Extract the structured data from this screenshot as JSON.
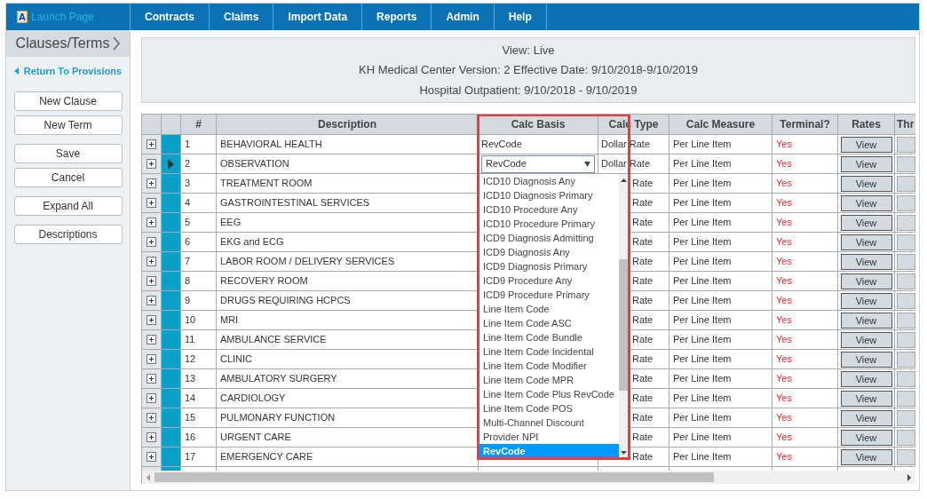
{
  "top_bar": {
    "launch_page": "Launch Page",
    "logo_letter": "A",
    "menu": [
      {
        "label": "Contracts"
      },
      {
        "label": "Claims"
      },
      {
        "label": "Import Data"
      },
      {
        "label": "Reports"
      },
      {
        "label": "Admin"
      },
      {
        "label": "Help"
      }
    ]
  },
  "sidebar": {
    "title": "Clauses/Terms",
    "back_link": "Return To Provisions",
    "button_groups": [
      [
        "New Clause",
        "New Term"
      ],
      [
        "Save",
        "Cancel"
      ],
      [
        "Expand All"
      ],
      [
        "Descriptions"
      ]
    ]
  },
  "header": {
    "lines": [
      "View: Live",
      "KH Medical Center Version: 2 Effective Date: 9/10/2018-9/10/2019",
      "Hospital Outpatient: 9/10/2018 - 9/10/2019"
    ]
  },
  "table": {
    "columns": [
      "#",
      "Description",
      "Calc Basis",
      "Calc Type",
      "Calc Measure",
      "Terminal?",
      "Rates",
      "Thr"
    ],
    "rows": [
      {
        "number": "1",
        "description": "BEHAVIORAL HEALTH",
        "calc_basis": "RevCode",
        "calc_type": "Dollar Rate",
        "calc_measure": "Per Line Item",
        "terminal": "Yes",
        "rates": "View",
        "selected": false
      },
      {
        "number": "2",
        "description": "OBSERVATION",
        "calc_type": "Dollar Rate",
        "calc_measure": "Per Line Item",
        "terminal": "Yes",
        "rates": "View",
        "selected": true
      },
      {
        "number": "3",
        "description": "TREATMENT ROOM",
        "calc_type": "Rate",
        "calc_measure": "Per Line Item",
        "terminal": "Yes",
        "rates": "View",
        "selected": false
      },
      {
        "number": "4",
        "description": "GASTROINTESTINAL SERVICES",
        "calc_type": "Rate",
        "calc_measure": "Per Line Item",
        "terminal": "Yes",
        "rates": "View",
        "selected": false
      },
      {
        "number": "5",
        "description": "EEG",
        "calc_type": "Rate",
        "calc_measure": "Per Line Item",
        "terminal": "Yes",
        "rates": "View",
        "selected": false
      },
      {
        "number": "6",
        "description": "EKG and ECG",
        "calc_type": "Rate",
        "calc_measure": "Per Line Item",
        "terminal": "Yes",
        "rates": "View",
        "selected": false
      },
      {
        "number": "7",
        "description": "LABOR ROOM / DELIVERY SERVICES",
        "calc_type": "Rate",
        "calc_measure": "Per Line Item",
        "terminal": "Yes",
        "rates": "View",
        "selected": false
      },
      {
        "number": "8",
        "description": "RECOVERY ROOM",
        "calc_type": "Rate",
        "calc_measure": "Per Line Item",
        "terminal": "Yes",
        "rates": "View",
        "selected": false
      },
      {
        "number": "9",
        "description": "DRUGS REQUIRING HCPCS",
        "calc_type": "Rate",
        "calc_measure": "Per Line Item",
        "terminal": "Yes",
        "rates": "View",
        "selected": false
      },
      {
        "number": "10",
        "description": "MRI",
        "calc_type": "Rate",
        "calc_measure": "Per Line Item",
        "terminal": "Yes",
        "rates": "View",
        "selected": false
      },
      {
        "number": "11",
        "description": "AMBULANCE SERVICE",
        "calc_type": "Rate",
        "calc_measure": "Per Line Item",
        "terminal": "Yes",
        "rates": "View",
        "selected": false
      },
      {
        "number": "12",
        "description": "CLINIC",
        "calc_type": "Rate",
        "calc_measure": "Per Line Item",
        "terminal": "Yes",
        "rates": "View",
        "selected": false
      },
      {
        "number": "13",
        "description": "AMBULATORY SURGERY",
        "calc_type": "Rate",
        "calc_measure": "Per Line Item",
        "terminal": "Yes",
        "rates": "View",
        "selected": false
      },
      {
        "number": "14",
        "description": "CARDIOLOGY",
        "calc_type": "Rate",
        "calc_measure": "Per Line Item",
        "terminal": "Yes",
        "rates": "View",
        "selected": false
      },
      {
        "number": "15",
        "description": "PULMONARY FUNCTION",
        "calc_type": "Rate",
        "calc_measure": "Per Line Item",
        "terminal": "Yes",
        "rates": "View",
        "selected": false
      },
      {
        "number": "16",
        "description": "URGENT CARE",
        "calc_type": "Rate",
        "calc_measure": "Per Line Item",
        "terminal": "Yes",
        "rates": "View",
        "selected": false
      },
      {
        "number": "17",
        "description": "EMERGENCY CARE",
        "calc_type": "Rate",
        "calc_measure": "Per Line Item",
        "terminal": "Yes",
        "rates": "View",
        "selected": false
      }
    ]
  },
  "calc_basis_dropdown": {
    "value": "RevCode",
    "expanded": true,
    "options": [
      {
        "label": "ICD10 Diagnosis Any",
        "selected": false
      },
      {
        "label": "ICD10 Diagnosis Primary",
        "selected": false
      },
      {
        "label": "ICD10 Procedure Any",
        "selected": false
      },
      {
        "label": "ICD10 Procedure Primary",
        "selected": false
      },
      {
        "label": "ICD9 Diagnosis Admitting",
        "selected": false
      },
      {
        "label": "ICD9 Diagnosis Any",
        "selected": false
      },
      {
        "label": "ICD9 Diagnosis Primary",
        "selected": false
      },
      {
        "label": "ICD9 Procedure Any",
        "selected": false
      },
      {
        "label": "ICD9 Procedure Primary",
        "selected": false
      },
      {
        "label": "Line Item Code",
        "selected": false
      },
      {
        "label": "Line Item Code ASC",
        "selected": false
      },
      {
        "label": "Line Item Code Bundle",
        "selected": false
      },
      {
        "label": "Line Item Code Incidental",
        "selected": false
      },
      {
        "label": "Line Item Code Modifier",
        "selected": false
      },
      {
        "label": "Line Item Code MPR",
        "selected": false
      },
      {
        "label": "Line Item Code Plus RevCode",
        "selected": false
      },
      {
        "label": "Line Item Code POS",
        "selected": false
      },
      {
        "label": "Multi-Channel Discount",
        "selected": false
      },
      {
        "label": "Provider NPI",
        "selected": false
      },
      {
        "label": "RevCode",
        "selected": true
      }
    ]
  }
}
